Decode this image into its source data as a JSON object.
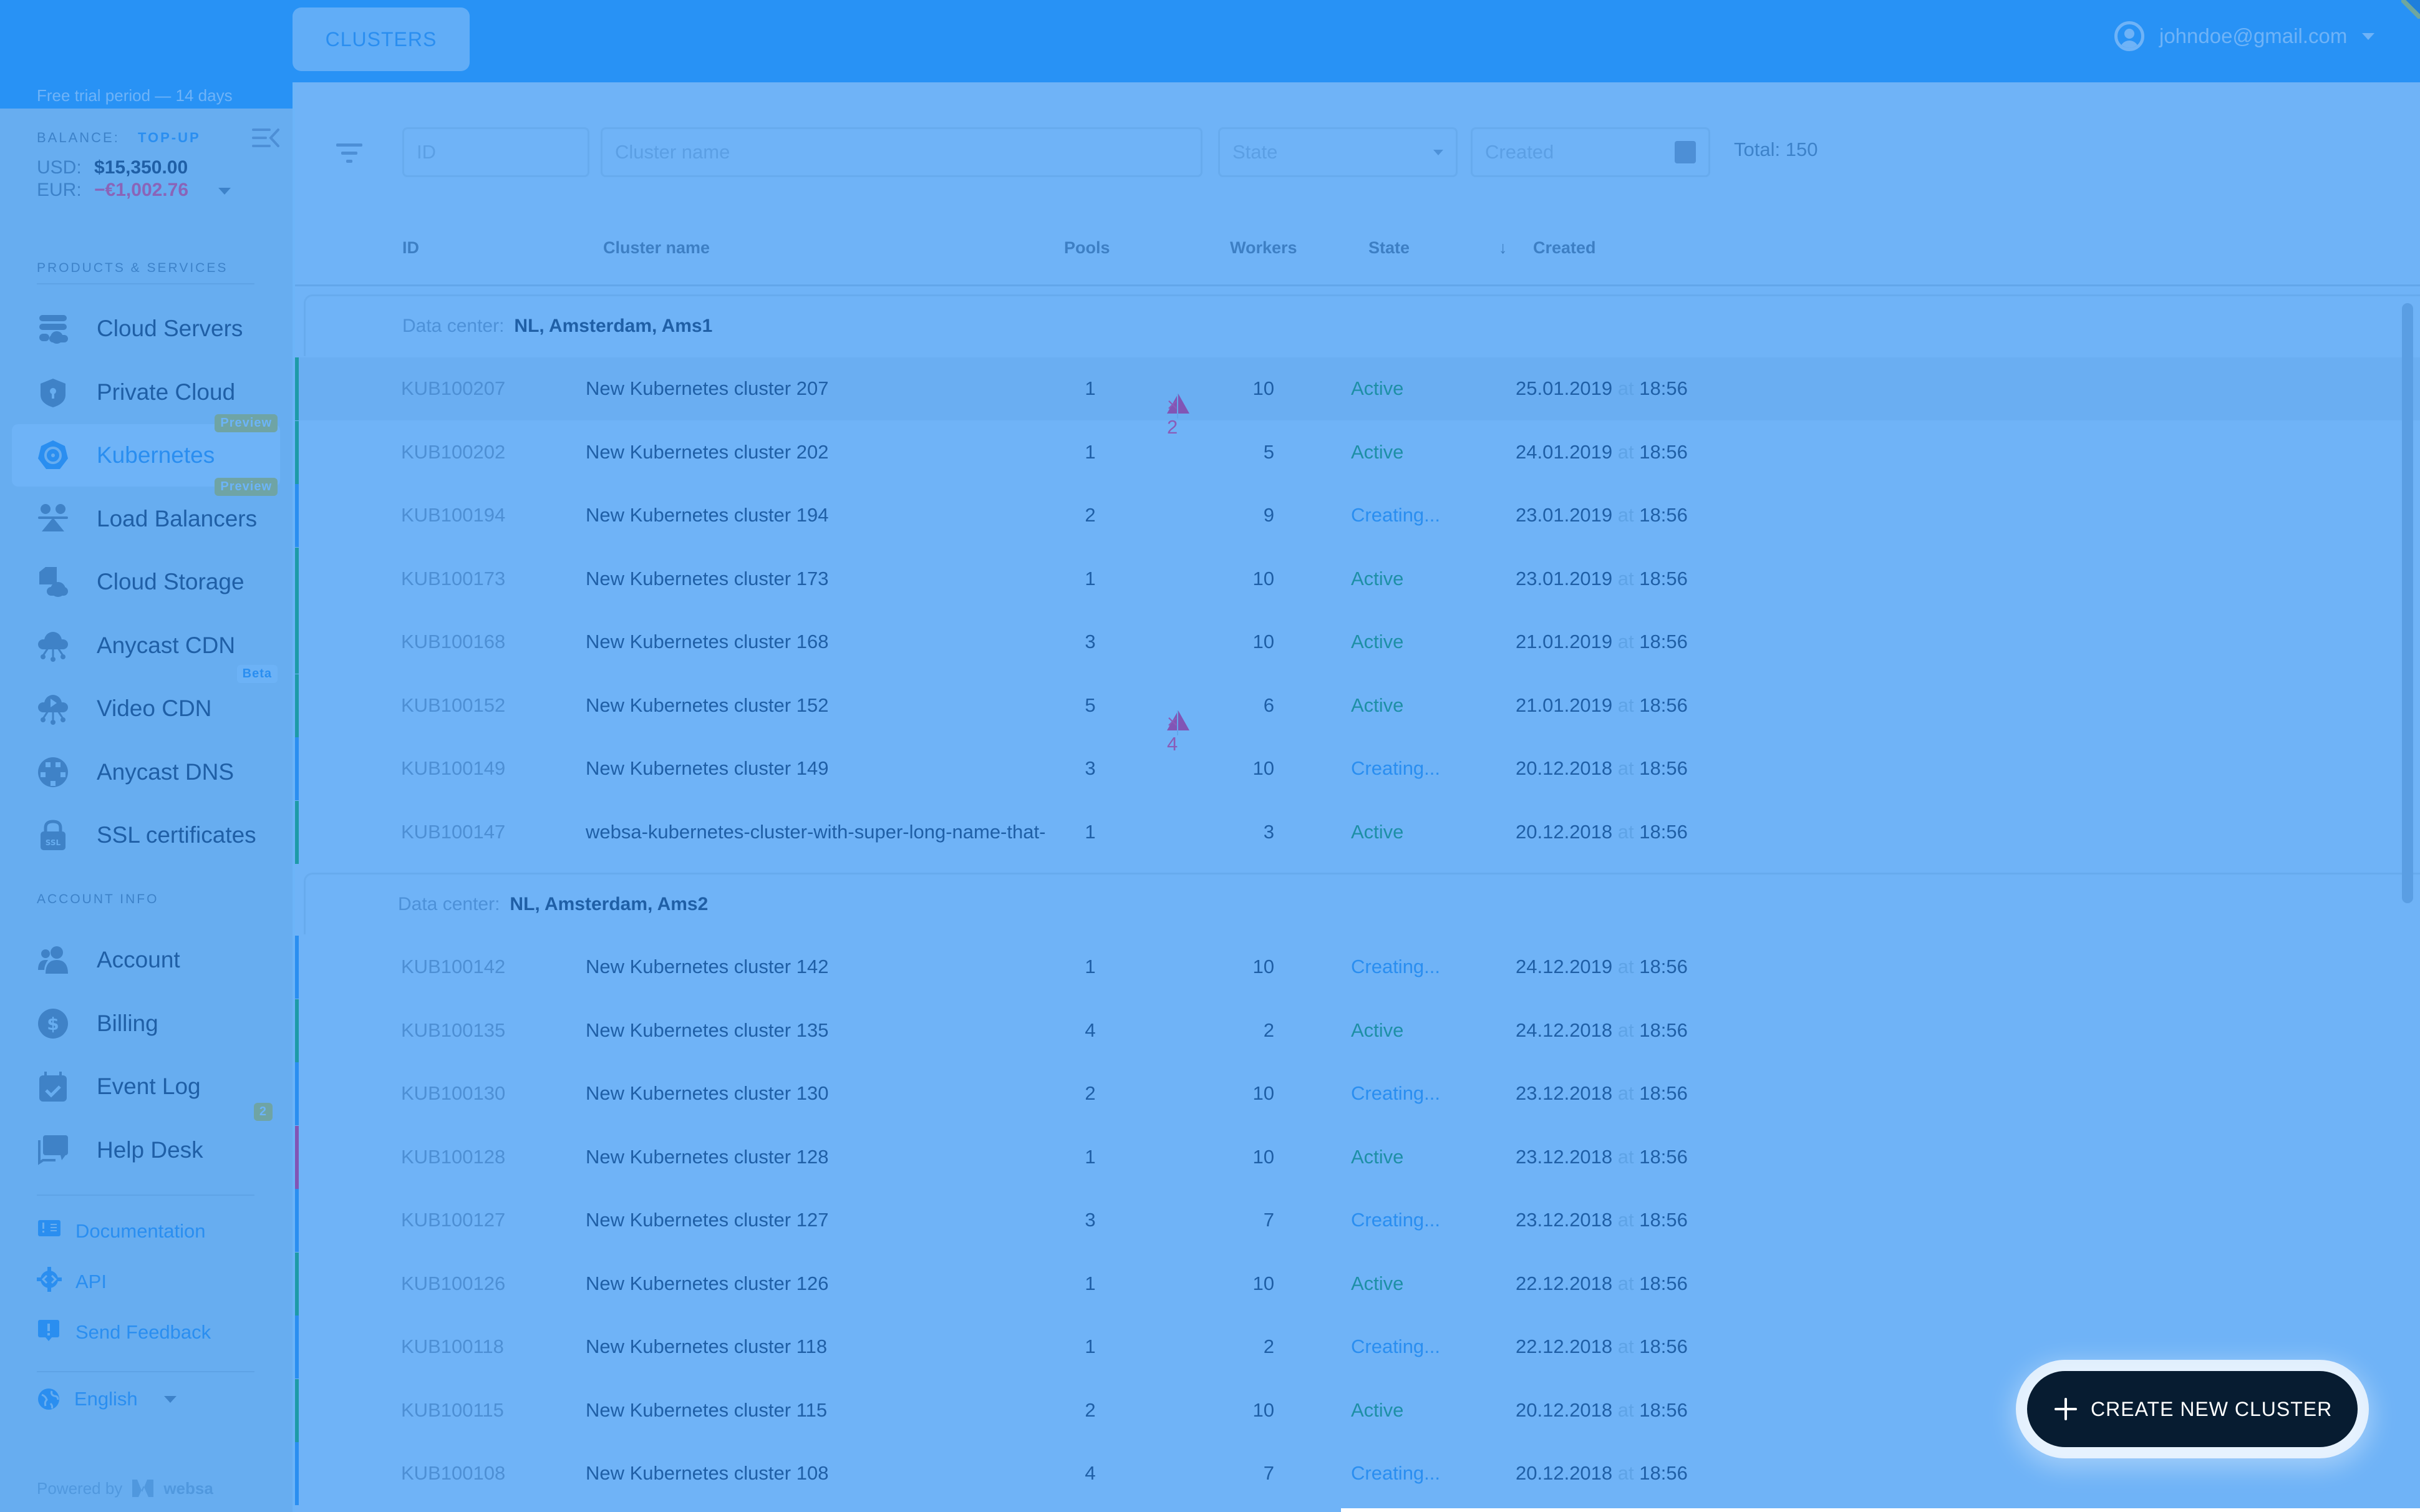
{
  "topbar": {
    "tab_label": "CLUSTERS",
    "user_email": "johndoe@gmail.com"
  },
  "sidebar": {
    "trial_text": "Free trial period — 14 days",
    "balance_label": "BALANCE:",
    "topup_label": "TOP-UP",
    "usd_label": "USD:",
    "usd_value": "$15,350.00",
    "eur_label": "EUR:",
    "eur_value": "−€1,002.76",
    "products_label": "PRODUCTS & SERVICES",
    "products": [
      {
        "label": "Cloud Servers",
        "icon": "cloud-servers-icon"
      },
      {
        "label": "Private Cloud",
        "icon": "shield-lock-icon"
      },
      {
        "label": "Kubernetes",
        "icon": "kubernetes-icon",
        "badge": "Preview",
        "active": true
      },
      {
        "label": "Load Balancers",
        "icon": "load-balancer-icon",
        "badge": "Preview"
      },
      {
        "label": "Cloud Storage",
        "icon": "cloud-storage-icon"
      },
      {
        "label": "Anycast CDN",
        "icon": "cloud-network-icon"
      },
      {
        "label": "Video CDN",
        "icon": "cloud-video-icon",
        "badge": "Beta"
      },
      {
        "label": "Anycast DNS",
        "icon": "dns-globe-icon"
      },
      {
        "label": "SSL certificates",
        "icon": "ssl-lock-icon"
      }
    ],
    "account_label": "ACCOUNT INFO",
    "account": [
      {
        "label": "Account",
        "icon": "users-icon"
      },
      {
        "label": "Billing",
        "icon": "dollar-icon"
      },
      {
        "label": "Event Log",
        "icon": "calendar-check-icon"
      },
      {
        "label": "Help Desk",
        "icon": "chat-icon",
        "badge": "2"
      }
    ],
    "links": [
      {
        "label": "Documentation",
        "icon": "book-icon"
      },
      {
        "label": "API",
        "icon": "api-gear-icon"
      },
      {
        "label": "Send Feedback",
        "icon": "feedback-icon"
      }
    ],
    "language": "English",
    "powered_by": "Powered by",
    "brand": "websa"
  },
  "filters": {
    "id_placeholder": "ID",
    "name_placeholder": "Cluster name",
    "state_placeholder": "State",
    "created_placeholder": "Created",
    "total": "Total: 150"
  },
  "table": {
    "columns": {
      "id": "ID",
      "name": "Cluster name",
      "pools": "Pools",
      "workers": "Workers",
      "state": "State",
      "created": "Created"
    },
    "groups": [
      {
        "dc_label": "Data center:",
        "dc_value": "NL, Amsterdam, Ams1",
        "rows": [
          {
            "id": "KUB100207",
            "name": "New Kubernetes cluster 207",
            "pools": "1",
            "warnings": "× 2",
            "workers": "10",
            "state": "Active",
            "date": "25.01.2019",
            "at": "at",
            "time": "18:56"
          },
          {
            "id": "KUB100202",
            "name": "New Kubernetes cluster 202",
            "pools": "1",
            "workers": "5",
            "state": "Active",
            "date": "24.01.2019",
            "at": "at",
            "time": "18:56"
          },
          {
            "id": "KUB100194",
            "name": "New Kubernetes cluster 194",
            "pools": "2",
            "workers": "9",
            "state": "Creating...",
            "date": "23.01.2019",
            "at": "at",
            "time": "18:56"
          },
          {
            "id": "KUB100173",
            "name": "New Kubernetes cluster 173",
            "pools": "1",
            "workers": "10",
            "state": "Active",
            "date": "23.01.2019",
            "at": "at",
            "time": "18:56"
          },
          {
            "id": "KUB100168",
            "name": "New Kubernetes cluster 168",
            "pools": "3",
            "workers": "10",
            "state": "Active",
            "date": "21.01.2019",
            "at": "at",
            "time": "18:56"
          },
          {
            "id": "KUB100152",
            "name": "New Kubernetes cluster 152",
            "pools": "5",
            "warnings": "× 4",
            "workers": "6",
            "state": "Active",
            "date": "21.01.2019",
            "at": "at",
            "time": "18:56"
          },
          {
            "id": "KUB100149",
            "name": "New Kubernetes cluster 149",
            "pools": "3",
            "workers": "10",
            "state": "Creating...",
            "date": "20.12.2018",
            "at": "at",
            "time": "18:56"
          },
          {
            "id": "KUB100147",
            "name": "websa-kubernetes-cluster-with-super-long-name-that-",
            "pools": "1",
            "workers": "3",
            "state": "Active",
            "date": "20.12.2018",
            "at": "at",
            "time": "18:56"
          }
        ]
      },
      {
        "dc_label": "Data center:",
        "dc_value": "NL, Amsterdam, Ams2",
        "rows": [
          {
            "id": "KUB100142",
            "name": "New Kubernetes cluster 142",
            "pools": "1",
            "workers": "10",
            "state": "Creating...",
            "date": "24.12.2019",
            "at": "at",
            "time": "18:56"
          },
          {
            "id": "KUB100135",
            "name": "New Kubernetes cluster 135",
            "pools": "4",
            "workers": "2",
            "state": "Active",
            "date": "24.12.2018",
            "at": "at",
            "time": "18:56"
          },
          {
            "id": "KUB100130",
            "name": "New Kubernetes cluster 130",
            "pools": "2",
            "workers": "10",
            "state": "Creating...",
            "date": "23.12.2018",
            "at": "at",
            "time": "18:56"
          },
          {
            "id": "KUB100128",
            "name": "New Kubernetes cluster 128",
            "pools": "1",
            "workers": "10",
            "state": "Active",
            "date": "23.12.2018",
            "at": "at",
            "time": "18:56",
            "stripe": "warning"
          },
          {
            "id": "KUB100127",
            "name": "New Kubernetes cluster 127",
            "pools": "3",
            "workers": "7",
            "state": "Creating...",
            "date": "23.12.2018",
            "at": "at",
            "time": "18:56"
          },
          {
            "id": "KUB100126",
            "name": "New Kubernetes cluster 126",
            "pools": "1",
            "workers": "10",
            "state": "Active",
            "date": "22.12.2018",
            "at": "at",
            "time": "18:56"
          },
          {
            "id": "KUB100118",
            "name": "New Kubernetes cluster 118",
            "pools": "1",
            "workers": "2",
            "state": "Creating...",
            "date": "22.12.2018",
            "at": "at",
            "time": "18:56"
          },
          {
            "id": "KUB100115",
            "name": "New Kubernetes cluster 115",
            "pools": "2",
            "workers": "10",
            "state": "Active",
            "date": "20.12.2018",
            "at": "at",
            "time": "18:56"
          },
          {
            "id": "KUB100108",
            "name": "New Kubernetes cluster 108",
            "pools": "4",
            "workers": "7",
            "state": "Creating...",
            "date": "20.12.2018",
            "at": "at",
            "time": "18:56"
          }
        ]
      }
    ]
  },
  "cta": {
    "label": "CREATE NEW CLUSTER"
  },
  "colors": {
    "active": "#1e9aa8",
    "creating": "#2a8ef0",
    "warning": "#8155b5",
    "brand": "#2892f5"
  }
}
